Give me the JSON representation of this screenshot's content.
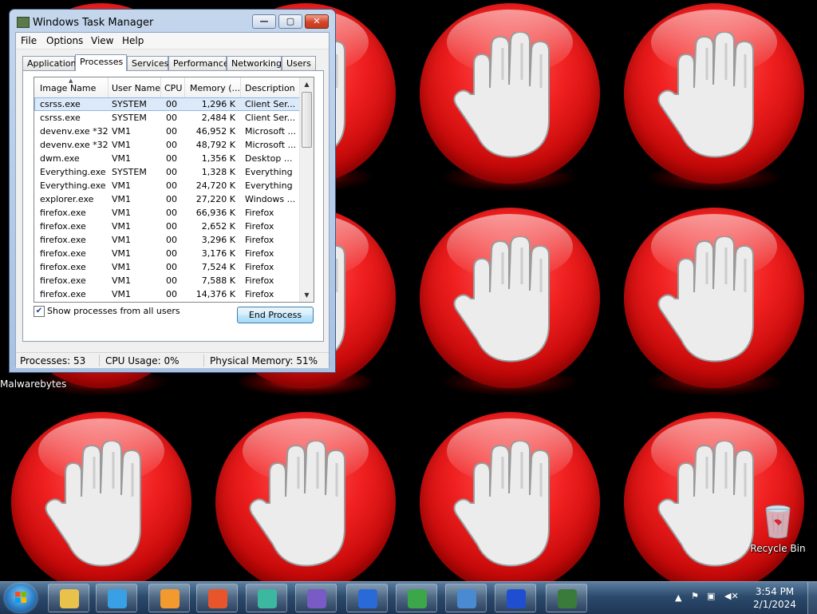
{
  "desktop": {
    "icons": [
      {
        "label": "Malwarebytes"
      },
      {
        "label": "Recycle Bin"
      }
    ]
  },
  "window": {
    "title": "Windows Task Manager",
    "controls": {
      "minimize": "—",
      "maximize": "▢",
      "close": "✕"
    },
    "menu": [
      "File",
      "Options",
      "View",
      "Help"
    ],
    "tabs": [
      "Applications",
      "Processes",
      "Services",
      "Performance",
      "Networking",
      "Users"
    ],
    "active_tab": "Processes",
    "columns": [
      "Image Name",
      "User Name",
      "CPU",
      "Memory (...",
      "Description"
    ],
    "processes": [
      {
        "name": "csrss.exe",
        "user": "SYSTEM",
        "cpu": "00",
        "memory": "1,296 K",
        "description": "Client Ser..."
      },
      {
        "name": "csrss.exe",
        "user": "SYSTEM",
        "cpu": "00",
        "memory": "2,484 K",
        "description": "Client Ser..."
      },
      {
        "name": "devenv.exe *32",
        "user": "VM1",
        "cpu": "00",
        "memory": "46,952 K",
        "description": "Microsoft ..."
      },
      {
        "name": "devenv.exe *32",
        "user": "VM1",
        "cpu": "00",
        "memory": "48,792 K",
        "description": "Microsoft ..."
      },
      {
        "name": "dwm.exe",
        "user": "VM1",
        "cpu": "00",
        "memory": "1,356 K",
        "description": "Desktop ..."
      },
      {
        "name": "Everything.exe",
        "user": "SYSTEM",
        "cpu": "00",
        "memory": "1,328 K",
        "description": "Everything"
      },
      {
        "name": "Everything.exe",
        "user": "VM1",
        "cpu": "00",
        "memory": "24,720 K",
        "description": "Everything"
      },
      {
        "name": "explorer.exe",
        "user": "VM1",
        "cpu": "00",
        "memory": "27,220 K",
        "description": "Windows ..."
      },
      {
        "name": "firefox.exe",
        "user": "VM1",
        "cpu": "00",
        "memory": "66,936 K",
        "description": "Firefox"
      },
      {
        "name": "firefox.exe",
        "user": "VM1",
        "cpu": "00",
        "memory": "2,652 K",
        "description": "Firefox"
      },
      {
        "name": "firefox.exe",
        "user": "VM1",
        "cpu": "00",
        "memory": "3,296 K",
        "description": "Firefox"
      },
      {
        "name": "firefox.exe",
        "user": "VM1",
        "cpu": "00",
        "memory": "3,176 K",
        "description": "Firefox"
      },
      {
        "name": "firefox.exe",
        "user": "VM1",
        "cpu": "00",
        "memory": "7,524 K",
        "description": "Firefox"
      },
      {
        "name": "firefox.exe",
        "user": "VM1",
        "cpu": "00",
        "memory": "7,588 K",
        "description": "Firefox"
      },
      {
        "name": "firefox.exe",
        "user": "VM1",
        "cpu": "00",
        "memory": "14,376 K",
        "description": "Firefox"
      }
    ],
    "show_all_label": "Show processes from all users",
    "show_all_checked": "✔",
    "end_process": "End Process",
    "status": {
      "processes": "Processes: 53",
      "cpu": "CPU Usage: 0%",
      "memory": "Physical Memory: 51%"
    }
  },
  "taskbar": {
    "apps": [
      {
        "icon": "file-explorer-icon",
        "color": "#e8c24a"
      },
      {
        "icon": "internet-explorer-icon",
        "color": "#3aa0e6"
      },
      {
        "icon": "media-player-icon",
        "color": "#f29a2e"
      },
      {
        "icon": "firefox-icon",
        "color": "#e8552a"
      },
      {
        "icon": "app-icon",
        "color": "#3db8a0"
      },
      {
        "icon": "visual-studio-icon",
        "color": "#7a5ac4"
      },
      {
        "icon": "malwarebytes-icon",
        "color": "#2a6ad8"
      },
      {
        "icon": "malwarebytes-setup-icon",
        "color": "#3ca64a"
      },
      {
        "icon": "control-panel-icon",
        "color": "#4a8ad0"
      },
      {
        "icon": "malwarebytes-icon",
        "color": "#1f4fd0"
      },
      {
        "icon": "task-manager-icon",
        "color": "#3a7a3a"
      }
    ],
    "clock_time": "3:54 PM",
    "clock_date": "2/1/2024"
  }
}
